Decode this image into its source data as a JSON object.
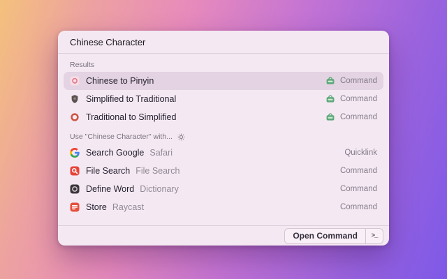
{
  "search": {
    "value": "Chinese Character"
  },
  "sections": [
    {
      "title": "Results",
      "items": [
        {
          "title": "Chinese to Pinyin",
          "icon": "pinyin-extension-icon",
          "accessory_icon": "green-extension-icon",
          "type": "Command",
          "selected": true
        },
        {
          "title": "Simplified to Traditional",
          "icon": "shield-icon",
          "accessory_icon": "green-extension-icon",
          "type": "Command",
          "selected": false
        },
        {
          "title": "Traditional to Simplified",
          "icon": "red-ring-icon",
          "accessory_icon": "green-extension-icon",
          "type": "Command",
          "selected": false
        }
      ]
    },
    {
      "title": "Use \"Chinese Character\" with...",
      "gear_icon": "gear-icon",
      "items": [
        {
          "title": "Search Google",
          "subtitle": "Safari",
          "icon": "google-icon",
          "type": "Quicklink"
        },
        {
          "title": "File Search",
          "subtitle": "File Search",
          "icon": "file-search-icon",
          "type": "Command"
        },
        {
          "title": "Define Word",
          "subtitle": "Dictionary",
          "icon": "dictionary-icon",
          "type": "Command"
        },
        {
          "title": "Store",
          "subtitle": "Raycast",
          "icon": "store-icon",
          "type": "Command"
        }
      ]
    }
  ],
  "footer": {
    "primary_action": "Open Command",
    "key_hint": ">_"
  },
  "colors": {
    "window_background": "#f4e9f2",
    "selected_row": "#e4d3e2",
    "green_icon": "#5ba878",
    "red_icon": "#e8433a",
    "store_icon": "#e5503e",
    "pink_icon": "#e2798f",
    "gradient": [
      "#f4c17c",
      "#eda39f",
      "#e78abc",
      "#c373d4",
      "#9b63de",
      "#7e59e7"
    ]
  }
}
